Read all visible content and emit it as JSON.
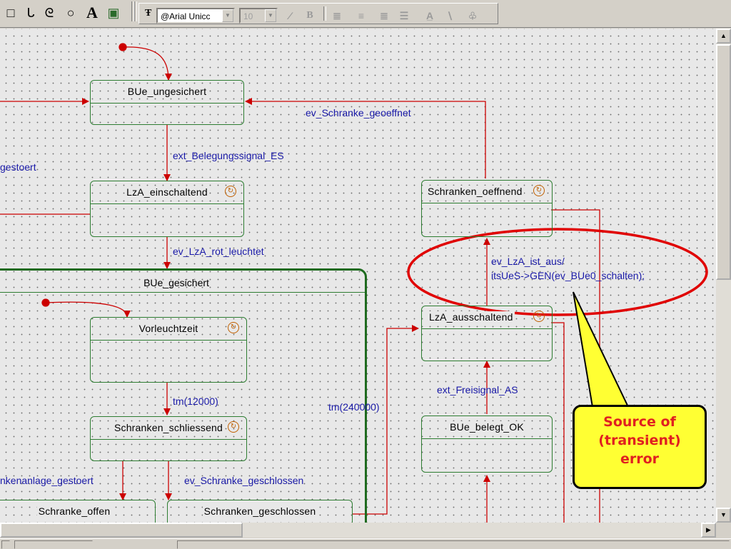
{
  "toolbar": {
    "font_name": "@Arial Unicc",
    "font_size": "10",
    "font_glyph": "Ŧ",
    "tools": [
      "□",
      "ᒐ",
      "ᘓ",
      "○",
      "A",
      "▣"
    ],
    "format_buttons": [
      "∕",
      "B",
      "≣",
      "≡",
      "≣",
      "☰",
      "A̲",
      "∖",
      "♧"
    ]
  },
  "states": {
    "bue_ungesichert": "BUe_ungesichert",
    "lza_einschaltend": "LzA_einschaltend",
    "bue_gesichert": "BUe_gesichert",
    "vorleuchtzeit": "Vorleuchtzeit",
    "schranken_schliessend": "Schranken_schliessend",
    "schranke_offen": "Schranke_offen",
    "schranken_geschlossen": "Schranken_geschlossen",
    "schranken_oeffnend": "Schranken_oeffnend",
    "lza_ausschaltend": "LzA_ausschaltend",
    "bue_belegt_ok": "BUe_belegt_OK"
  },
  "transitions": {
    "ev_schranke_geoeffnet": "ev_Schranke_geoeffnet",
    "ext_belegungssignal_es": "ext_Belegungssignal_ES",
    "gestoert": "gestoert",
    "ev_lza_rot_leuchtet": "ev_LzA_rot_leuchtet",
    "ev_lza_ist_aus": "ev_LzA_ist_aus/",
    "its_action": "itsUeS->GEN(ev_BUe0_schalten);",
    "ext_freisignal_as": "ext_Freisignal_AS",
    "tm_12000": "tm(12000)",
    "tm_240000": "tm(240000)",
    "schrankenanlage_gestoert": "nkenanlage_gestoert",
    "ev_schranke_geschlossen": "ev_Schranke_geschlossen"
  },
  "callout": {
    "line1": "Source of",
    "line2": "(transient)",
    "line3": "error"
  },
  "colors": {
    "transition_arrow": "#cc0000",
    "state_border": "#2e7d32",
    "label_text": "#1a1aa8",
    "highlight_ellipse": "#e00000",
    "callout_fill": "#ffff33"
  }
}
